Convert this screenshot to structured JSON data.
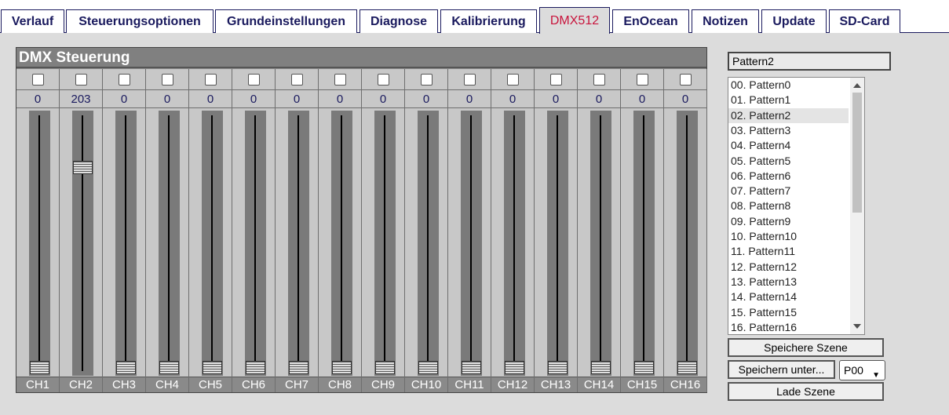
{
  "tabs": [
    {
      "label": "Verlauf",
      "active": false
    },
    {
      "label": "Steuerungsoptionen",
      "active": false
    },
    {
      "label": "Grundeinstellungen",
      "active": false
    },
    {
      "label": "Diagnose",
      "active": false
    },
    {
      "label": "Kalibrierung",
      "active": false
    },
    {
      "label": "DMX512",
      "active": true
    },
    {
      "label": "EnOcean",
      "active": false
    },
    {
      "label": "Notizen",
      "active": false
    },
    {
      "label": "Update",
      "active": false
    },
    {
      "label": "SD-Card",
      "active": false
    }
  ],
  "dmx": {
    "title": "DMX Steuerung",
    "max_value": 255,
    "channels": [
      {
        "label": "CH1",
        "value": "0",
        "checked": false
      },
      {
        "label": "CH2",
        "value": "203",
        "checked": false
      },
      {
        "label": "CH3",
        "value": "0",
        "checked": false
      },
      {
        "label": "CH4",
        "value": "0",
        "checked": false
      },
      {
        "label": "CH5",
        "value": "0",
        "checked": false
      },
      {
        "label": "CH6",
        "value": "0",
        "checked": false
      },
      {
        "label": "CH7",
        "value": "0",
        "checked": false
      },
      {
        "label": "CH8",
        "value": "0",
        "checked": false
      },
      {
        "label": "CH9",
        "value": "0",
        "checked": false
      },
      {
        "label": "CH10",
        "value": "0",
        "checked": false
      },
      {
        "label": "CH11",
        "value": "0",
        "checked": false
      },
      {
        "label": "CH12",
        "value": "0",
        "checked": false
      },
      {
        "label": "CH13",
        "value": "0",
        "checked": false
      },
      {
        "label": "CH14",
        "value": "0",
        "checked": false
      },
      {
        "label": "CH15",
        "value": "0",
        "checked": false
      },
      {
        "label": "CH16",
        "value": "0",
        "checked": false
      }
    ]
  },
  "scene": {
    "name_value": "Pattern2",
    "patterns": [
      "00. Pattern0",
      "01. Pattern1",
      "02. Pattern2",
      "03. Pattern3",
      "04. Pattern4",
      "05. Pattern5",
      "06. Pattern6",
      "07. Pattern7",
      "08. Pattern8",
      "09. Pattern9",
      "10. Pattern10",
      "11. Pattern11",
      "12. Pattern12",
      "13. Pattern13",
      "14. Pattern14",
      "15. Pattern15",
      "16. Pattern16"
    ],
    "selected_index": 2,
    "save_label": "Speichere Szene",
    "save_as_label": "Speichern unter...",
    "slot_value": "P00",
    "load_label": "Lade Szene"
  },
  "icons": {
    "scroll_up": "arrow-up-icon",
    "scroll_down": "arrow-down-icon",
    "select_chevron": "chevron-down-icon"
  }
}
